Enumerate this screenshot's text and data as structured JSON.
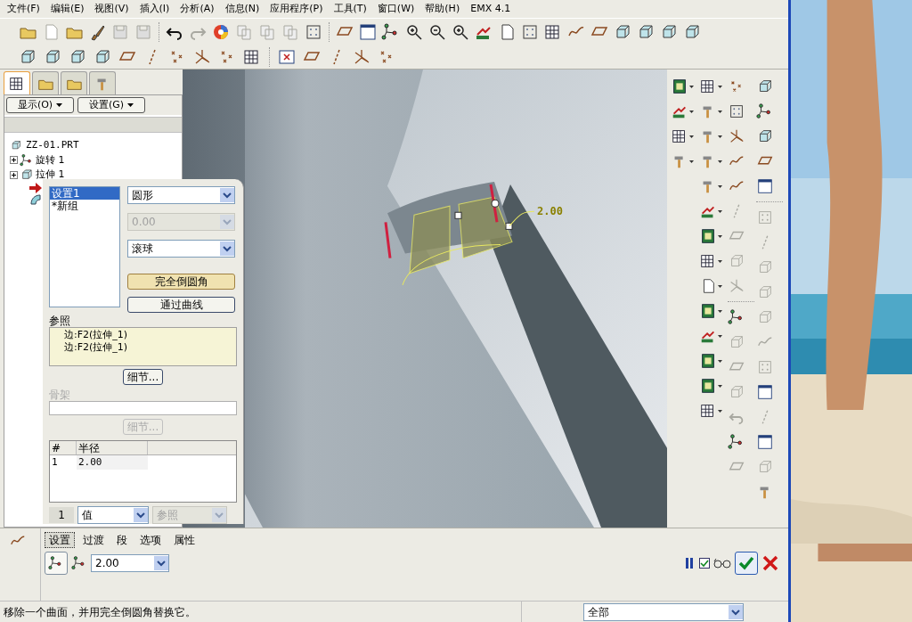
{
  "menu": [
    "文件(F)",
    "编辑(E)",
    "视图(V)",
    "插入(I)",
    "分析(A)",
    "信息(N)",
    "应用程序(P)",
    "工具(T)",
    "窗口(W)",
    "帮助(H)",
    "EMX 4.1"
  ],
  "navigator": {
    "tabs": [
      {
        "selected": true
      },
      {
        "selected": false
      },
      {
        "selected": false
      },
      {
        "selected": false
      }
    ],
    "buttons": [
      "显示(O)",
      "设置(G)"
    ],
    "tree": {
      "label": "ZZ-01.PRT",
      "children": [
        {
          "label": "旋转 1",
          "expanded": false
        },
        {
          "label": "拉伸 1",
          "expanded": false
        }
      ]
    }
  },
  "fillet_panel": {
    "sets": [
      {
        "label": "设置1",
        "selected": true
      },
      {
        "label": "*新组",
        "selected": false
      }
    ],
    "shape": "圆形",
    "value": {
      "text": "0.00",
      "disabled": true
    },
    "method": "滚球",
    "buttons": [
      {
        "label": "完全倒圆角",
        "highlighted": true
      },
      {
        "label": "通过曲线",
        "highlighted": false
      }
    ],
    "references_label": "参照",
    "references": [
      "边:F2(拉伸_1)",
      "边:F2(拉伸_1)"
    ],
    "details": {
      "label": "细节...",
      "disabled": false
    },
    "skeleton_label": "骨架",
    "skeleton_details": {
      "label": "细节...",
      "disabled": true
    },
    "table": {
      "columns": [
        "#",
        "半径"
      ],
      "rows": [
        [
          "1",
          "2.00"
        ]
      ]
    },
    "footer": {
      "index": "1",
      "type": "值",
      "reference": "参照",
      "reference_disabled": true
    }
  },
  "viewport": {
    "dimension": "2.00"
  },
  "dashboard": {
    "tabs": [
      {
        "label": "设置",
        "selected": true
      },
      {
        "label": "过渡",
        "selected": false
      },
      {
        "label": "段",
        "selected": false
      },
      {
        "label": "选项",
        "selected": false
      },
      {
        "label": "属性",
        "selected": false
      }
    ],
    "radius": "2.00",
    "preview_checked": true
  },
  "status_bar": {
    "message": "移除一个曲面，并用完全倒圆角替换它。",
    "filter": "全部"
  }
}
